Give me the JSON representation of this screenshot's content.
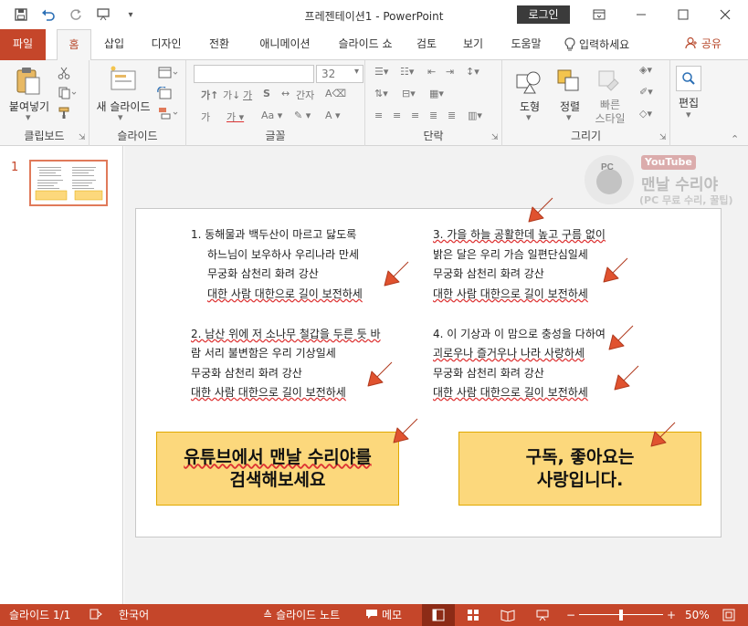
{
  "window": {
    "doc_title": "프레젠테이션1  -  PowerPoint",
    "login_label": "로그인"
  },
  "tabs": [
    "파일",
    "홈",
    "삽입",
    "디자인",
    "전환",
    "애니메이션",
    "슬라이드 쇼",
    "검토",
    "보기",
    "도움말"
  ],
  "tell_me": "입력하세요",
  "share_label": "공유",
  "ribbon": {
    "groups": {
      "clipboard": "클립보드",
      "slides": "슬라이드",
      "font": "글꼴",
      "paragraph": "단락",
      "drawing": "그리기",
      "editing_group": ""
    },
    "paste_label": "붙여넣기",
    "new_slide_label": "새 슬라이드",
    "font_size": "32",
    "shapes_label": "도형",
    "arrange_label": "정렬",
    "quick_style_line1": "빠른",
    "quick_style_line2": "스타일",
    "edit_label": "편집"
  },
  "pane": {
    "slide_number": "1"
  },
  "watermark": {
    "top": "YouTube",
    "name": "맨날 수리야",
    "sub": "(PC 무료 수리, 꿀팁)"
  },
  "slide": {
    "verse1": [
      "1.  동해물과 백두산이 마르고 닳도록",
      "하느님이 보우하사 우리나라 만세",
      "무궁화 삼천리 화려 강산",
      "대한 사람 대한으로 길이 보전하세"
    ],
    "verse2": [
      "2. 남산 위에 저 소나무 철갑을 두른 듯 바",
      "람 서리 불변함은 우리 기상일세",
      "무궁화 삼천리 화려 강산",
      "대한 사람 대한으로 길이 보전하세"
    ],
    "verse3": [
      "3. 가을 하늘 공활한데 높고 구름 없이",
      "밝은 달은 우리 가슴 일편단심일세",
      "무궁화 삼천리 화려 강산",
      "대한 사람 대한으로 길이 보전하세"
    ],
    "verse4": [
      "4. 이 기상과 이 맘으로 충성을 다하여",
      "괴로우나 즐거우나 나라 사랑하세",
      "무궁화 삼천리 화려 강산",
      "대한 사람 대한으로 길이 보전하세"
    ],
    "box_left": [
      "유튜브에서 맨날 수리야를",
      "검색해보세요"
    ],
    "box_right": [
      "구독, 좋아요는",
      "사랑입니다."
    ]
  },
  "status": {
    "slide_count": "슬라이드 1/1",
    "language": "한국어",
    "notes": "슬라이드 노트",
    "comments": "메모",
    "zoom": "50%"
  },
  "colors": {
    "accent": "#c5462a",
    "box_fill": "#fcd87c",
    "arrow": "#e0522f"
  }
}
